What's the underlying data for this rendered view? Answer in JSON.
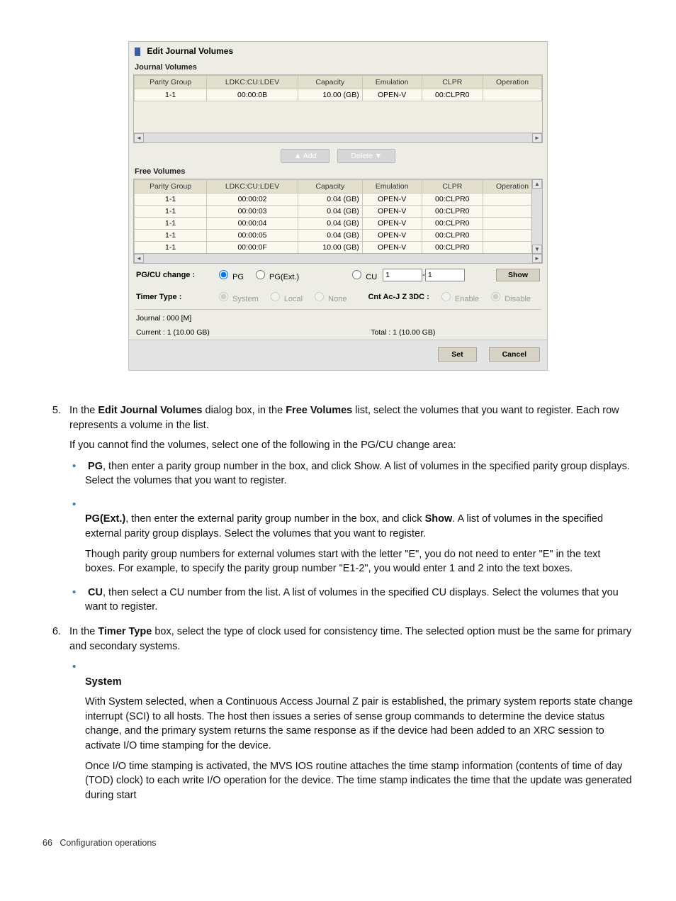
{
  "dialog": {
    "title": "Edit Journal Volumes",
    "journal_section": "Journal Volumes",
    "free_section": "Free Volumes",
    "cols": [
      "Parity Group",
      "LDKC:CU:LDEV",
      "Capacity",
      "Emulation",
      "CLPR",
      "Operation"
    ],
    "journal_rows": [
      {
        "pg": "1-1",
        "ldev": "00:00:0B",
        "cap": "10.00 (GB)",
        "emu": "OPEN-V",
        "clpr": "00:CLPR0",
        "op": ""
      }
    ],
    "free_rows": [
      {
        "pg": "1-1",
        "ldev": "00:00:02",
        "cap": "0.04 (GB)",
        "emu": "OPEN-V",
        "clpr": "00:CLPR0",
        "op": ""
      },
      {
        "pg": "1-1",
        "ldev": "00:00:03",
        "cap": "0.04 (GB)",
        "emu": "OPEN-V",
        "clpr": "00:CLPR0",
        "op": ""
      },
      {
        "pg": "1-1",
        "ldev": "00:00:04",
        "cap": "0.04 (GB)",
        "emu": "OPEN-V",
        "clpr": "00:CLPR0",
        "op": ""
      },
      {
        "pg": "1-1",
        "ldev": "00:00:05",
        "cap": "0.04 (GB)",
        "emu": "OPEN-V",
        "clpr": "00:CLPR0",
        "op": ""
      },
      {
        "pg": "1-1",
        "ldev": "00:00:0F",
        "cap": "10.00 (GB)",
        "emu": "OPEN-V",
        "clpr": "00:CLPR0",
        "op": ""
      }
    ],
    "btn_add": "Add",
    "btn_del": "Delete",
    "pgcu_label": "PG/CU change :",
    "pg_radio": "PG",
    "pgext_radio": "PG(Ext.)",
    "cu_radio": "CU",
    "pgcu_val1": "1",
    "pgcu_sep": " - ",
    "pgcu_val2": "1",
    "show_btn": "Show",
    "timer_label": "Timer Type :",
    "timer_system": "System",
    "timer_local": "Local",
    "timer_none": "None",
    "cnt_label": "Cnt Ac-J Z 3DC :",
    "cnt_enable": "Enable",
    "cnt_disable": "Disable",
    "journal_info": "Journal : 000 [M]",
    "current_info": "Current : 1 (10.00 GB)",
    "total_info": "Total : 1 (10.00 GB)",
    "set_btn": "Set",
    "cancel_btn": "Cancel"
  },
  "doc": {
    "step5_a": "In the ",
    "step5_b": "Edit Journal Volumes",
    "step5_c": " dialog box, in the ",
    "step5_d": "Free Volumes",
    "step5_e": " list, select the volumes that you want to register. Each row represents a volume in the list.",
    "step5_p2": "If you cannot find the volumes, select one of the following in the PG/CU change area:",
    "b1_a": "PG",
    "b1_b": ", then enter a parity group number in the box, and click Show. A list of volumes in the specified parity group displays. Select the volumes that you want to register.",
    "b2_a": "PG(Ext.)",
    "b2_b": ", then enter the external parity group number in the box, and click ",
    "b2_c": "Show",
    "b2_d": ". A list of volumes in the specified external parity group displays. Select the volumes that you want to register.",
    "b2_p2": "Though parity group numbers for external volumes start with the letter \"E\", you do not need to enter \"E\" in the text boxes. For example, to specify the parity group number \"E1-2\", you would enter 1 and 2 into the text boxes.",
    "b3_a": "CU",
    "b3_b": ", then select a CU number from the list. A list of volumes in the specified CU displays. Select the volumes that you want to register.",
    "step6_a": "In the ",
    "step6_b": "Timer Type",
    "step6_c": " box, select the type of clock used for consistency time. The selected option must be the same for primary and secondary systems.",
    "s6_b1": "System",
    "s6_b1_p1": "With System selected, when a Continuous Access Journal Z pair is established, the primary system reports state change interrupt (SCI) to all hosts. The host then issues a series of sense group commands to determine the device status change, and the primary system returns the same response as if the device had been added to an XRC session to activate I/O time stamping for the device.",
    "s6_b1_p2": "Once I/O time stamping is activated, the MVS IOS routine attaches the time stamp information (contents of time of day (TOD) clock) to each write I/O operation for the device. The time stamp indicates the time that the update was generated during start"
  },
  "footer": {
    "page": "66",
    "title": "Configuration operations"
  }
}
